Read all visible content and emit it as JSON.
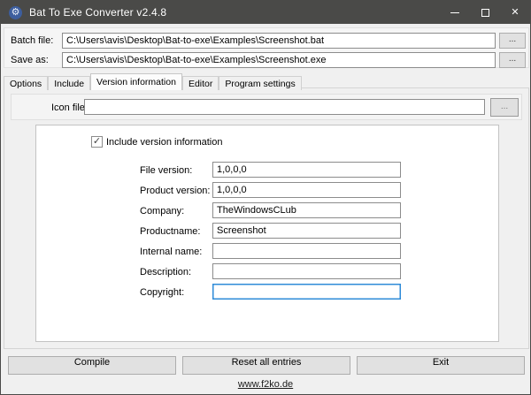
{
  "window": {
    "title": "Bat To Exe Converter v2.4.8"
  },
  "icons": {
    "app_gear": "⚙",
    "close": "✕",
    "check": "✓"
  },
  "file_inputs": {
    "batch_label": "Batch file:",
    "batch_value": "C:\\Users\\avis\\Desktop\\Bat-to-exe\\Examples\\Screenshot.bat",
    "save_label": "Save as:",
    "save_value": "C:\\Users\\avis\\Desktop\\Bat-to-exe\\Examples\\Screenshot.exe",
    "browse_label": "..."
  },
  "tabs": [
    {
      "label": "Options"
    },
    {
      "label": "Include"
    },
    {
      "label": "Version information"
    },
    {
      "label": "Editor"
    },
    {
      "label": "Program settings"
    }
  ],
  "icon_file": {
    "label": "Icon file:",
    "value": "",
    "browse_label": "..."
  },
  "version_form": {
    "checkbox_label": "Include version information",
    "checked": true,
    "fields": [
      {
        "label": "File version:",
        "value": "1,0,0,0"
      },
      {
        "label": "Product version:",
        "value": "1,0,0,0"
      },
      {
        "label": "Company:",
        "value": "TheWindowsCLub"
      },
      {
        "label": "Productname:",
        "value": "Screenshot"
      },
      {
        "label": "Internal name:",
        "value": ""
      },
      {
        "label": "Description:",
        "value": ""
      },
      {
        "label": "Copyright:",
        "value": ""
      }
    ]
  },
  "footer": {
    "compile_label": "Compile",
    "reset_label": "Reset all entries",
    "exit_label": "Exit",
    "link": "www.f2ko.de"
  },
  "colors": {
    "titlebar": "#4a4a48",
    "focus_accent": "#2e8bd8",
    "button_face": "#e1e1e1"
  }
}
